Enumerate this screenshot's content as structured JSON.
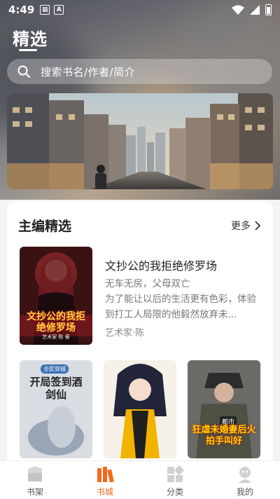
{
  "status": {
    "time": "4:49",
    "notification_icons": [
      "grid-app-icon",
      "a-app-icon"
    ]
  },
  "header": {
    "title": "精选"
  },
  "search": {
    "placeholder": "搜索书名/作者/简介"
  },
  "section": {
    "title": "主编精选",
    "more_label": "更多",
    "featured": {
      "title": "文抄公的我拒绝修罗场",
      "description": "无车无房，父母双亡\n为了能让以后的生活更有色彩，体验到打工人局限的他毅然放弃未...",
      "author": "艺术家·陈",
      "cover_text": "文抄公的我拒绝修罗场",
      "cover_author": "艺术家·陈 著"
    },
    "books": [
      {
        "cover_text": "开局签到酒剑仙",
        "cover_badge": "全民穿越"
      },
      {
        "cover_text": ""
      },
      {
        "cover_text": "狂虐未婚妻后火拍手叫好",
        "cover_badge": "都市"
      }
    ]
  },
  "nav": [
    {
      "label": "书架",
      "icon": "bookshelf-icon"
    },
    {
      "label": "书城",
      "icon": "bookstore-icon",
      "active": true
    },
    {
      "label": "分类",
      "icon": "category-icon"
    },
    {
      "label": "我的",
      "icon": "profile-icon"
    }
  ],
  "colors": {
    "accent": "#f26b1d",
    "text": "#222222",
    "muted": "#777777"
  }
}
